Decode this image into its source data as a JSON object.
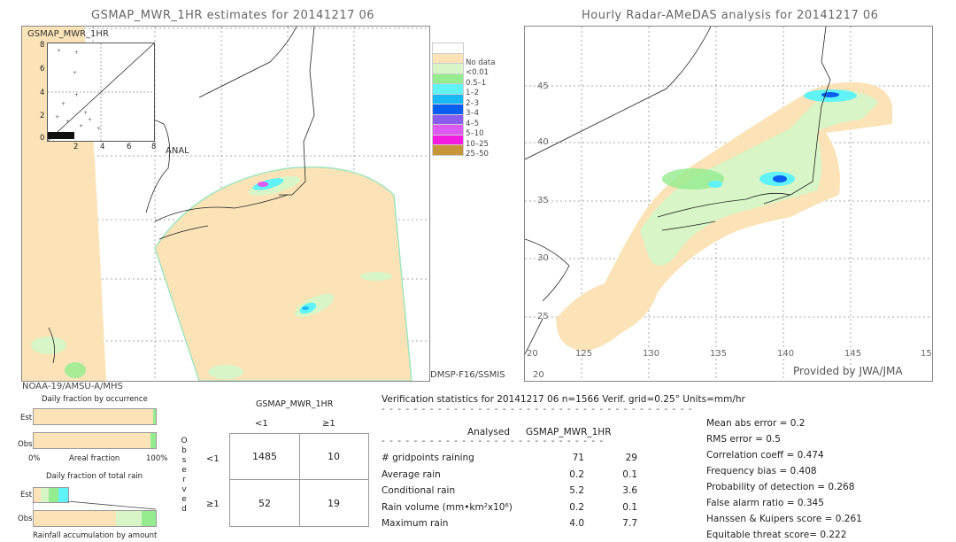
{
  "left_panel": {
    "title": "GSMAP_MWR_1HR estimates for 20141217 06",
    "inset_label": "GSMAP_MWR_1HR",
    "inset_axis_label": "ANAL",
    "inset_y_ticks": [
      "8",
      "6",
      "4",
      "2",
      "0"
    ],
    "inset_x_ticks": [
      "2",
      "4",
      "6",
      "8"
    ],
    "sensor_right": "DMSP-F16/SSMIS",
    "sensor_bottom": "NOAA-19/AMSU-A/MHS"
  },
  "right_panel": {
    "title": "Hourly Radar-AMeDAS analysis for 20141217 06",
    "lat_ticks": [
      "45",
      "40",
      "35",
      "30",
      "25",
      "20"
    ],
    "lon_ticks": [
      "125",
      "130",
      "135",
      "140",
      "145",
      "15"
    ],
    "lon_start": "20",
    "credit": "Provided by JWA/JMA"
  },
  "legend": {
    "items": [
      {
        "label": "",
        "color": "#ffffff"
      },
      {
        "label": "No data",
        "color": "#fbe3b7"
      },
      {
        "label": "<0.01",
        "color": "#d7f5c6"
      },
      {
        "label": "0.5–1",
        "color": "#94ec8f"
      },
      {
        "label": "1–2",
        "color": "#5ff3f7"
      },
      {
        "label": "2–3",
        "color": "#19b9f5"
      },
      {
        "label": "3–4",
        "color": "#0a5ef0"
      },
      {
        "label": "4–5",
        "color": "#8a5cf0"
      },
      {
        "label": "5–10",
        "color": "#dc5af0"
      },
      {
        "label": "10–25",
        "color": "#f41be0"
      },
      {
        "label": "25–50",
        "color": "#c8963a"
      }
    ]
  },
  "occurrence": {
    "title": "Daily fraction by occurrence",
    "est_label": "Est",
    "obs_label": "Obs",
    "axis_left": "0%",
    "axis_mid": "Areal fraction",
    "axis_right": "100%",
    "est_fraction_nodata": 0.98,
    "obs_fraction_nodata": 0.96
  },
  "total_rain": {
    "title": "Daily fraction of total rain",
    "est_label": "Est",
    "obs_label": "Obs",
    "footer": "Rainfall accumulation by amount"
  },
  "contingency": {
    "header": "GSMAP_MWR_1HR",
    "col_labels": [
      "<1",
      "≥1"
    ],
    "row_labels": [
      "<1",
      "≥1"
    ],
    "side_label": [
      "O",
      "b",
      "s",
      "e",
      "r",
      "v",
      "e",
      "d"
    ],
    "cells": [
      [
        "1485",
        "10"
      ],
      [
        "52",
        "19"
      ]
    ]
  },
  "verification": {
    "header": "Verification statistics for 20141217 06   n=1566   Verif. grid=0.25°   Units=mm/hr",
    "col_analysed": "Analysed",
    "col_est": "GSMAP_MWR_1HR",
    "rows": [
      {
        "label": "# gridpoints raining",
        "analysed": "71",
        "est": "29"
      },
      {
        "label": "Average rain",
        "analysed": "0.2",
        "est": "0.1"
      },
      {
        "label": "Conditional rain",
        "analysed": "5.2",
        "est": "3.6"
      },
      {
        "label": "Rain volume (mm•km²x10⁶)",
        "analysed": "0.2",
        "est": "0.1"
      },
      {
        "label": "Maximum rain",
        "analysed": "4.0",
        "est": "7.7"
      }
    ],
    "scores": [
      "Mean abs error = 0.2",
      "RMS error = 0.5",
      "Correlation coeff = 0.474",
      "Frequency bias = 0.408",
      "Probability of detection = 0.268",
      "False alarm ratio = 0.345",
      "Hanssen & Kuipers score = 0.261",
      "Equitable threat score= 0.222"
    ]
  }
}
